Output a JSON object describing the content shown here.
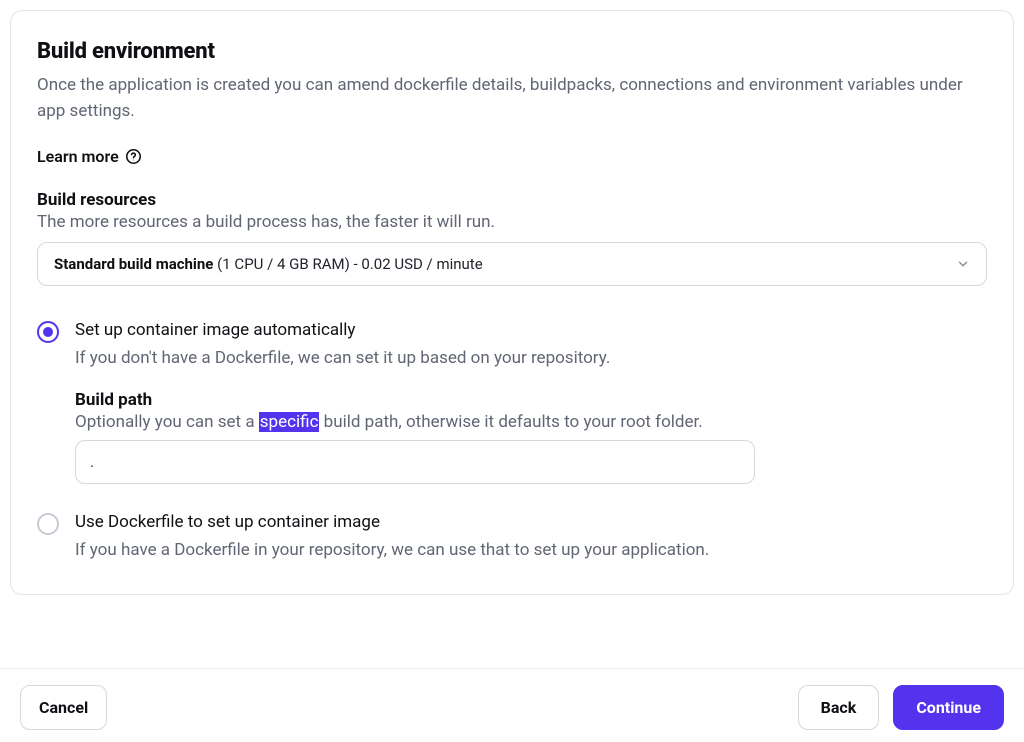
{
  "section": {
    "title": "Build environment",
    "description": "Once the application is created you can amend dockerfile details, buildpacks, connections and environment variables under app settings.",
    "learn_more": "Learn more"
  },
  "build_resources": {
    "heading": "Build resources",
    "description": "The more resources a build process has, the faster it will run.",
    "selected_strong": "Standard build machine",
    "selected_rest": " (1 CPU / 4 GB RAM) - 0.02 USD / minute"
  },
  "options": {
    "auto": {
      "title": "Set up container image automatically",
      "description": "If you don't have a Dockerfile, we can set it up based on your repository.",
      "build_path_heading": "Build path",
      "build_path_desc_pre": "Optionally you can set a ",
      "build_path_desc_hl": "specific",
      "build_path_desc_post": " build path, otherwise it defaults to your root folder.",
      "build_path_value": "."
    },
    "dockerfile": {
      "title": "Use Dockerfile to set up container image",
      "description": "If you have a Dockerfile in your repository, we can use that to set up your application."
    }
  },
  "footer": {
    "cancel": "Cancel",
    "back": "Back",
    "continue": "Continue"
  }
}
